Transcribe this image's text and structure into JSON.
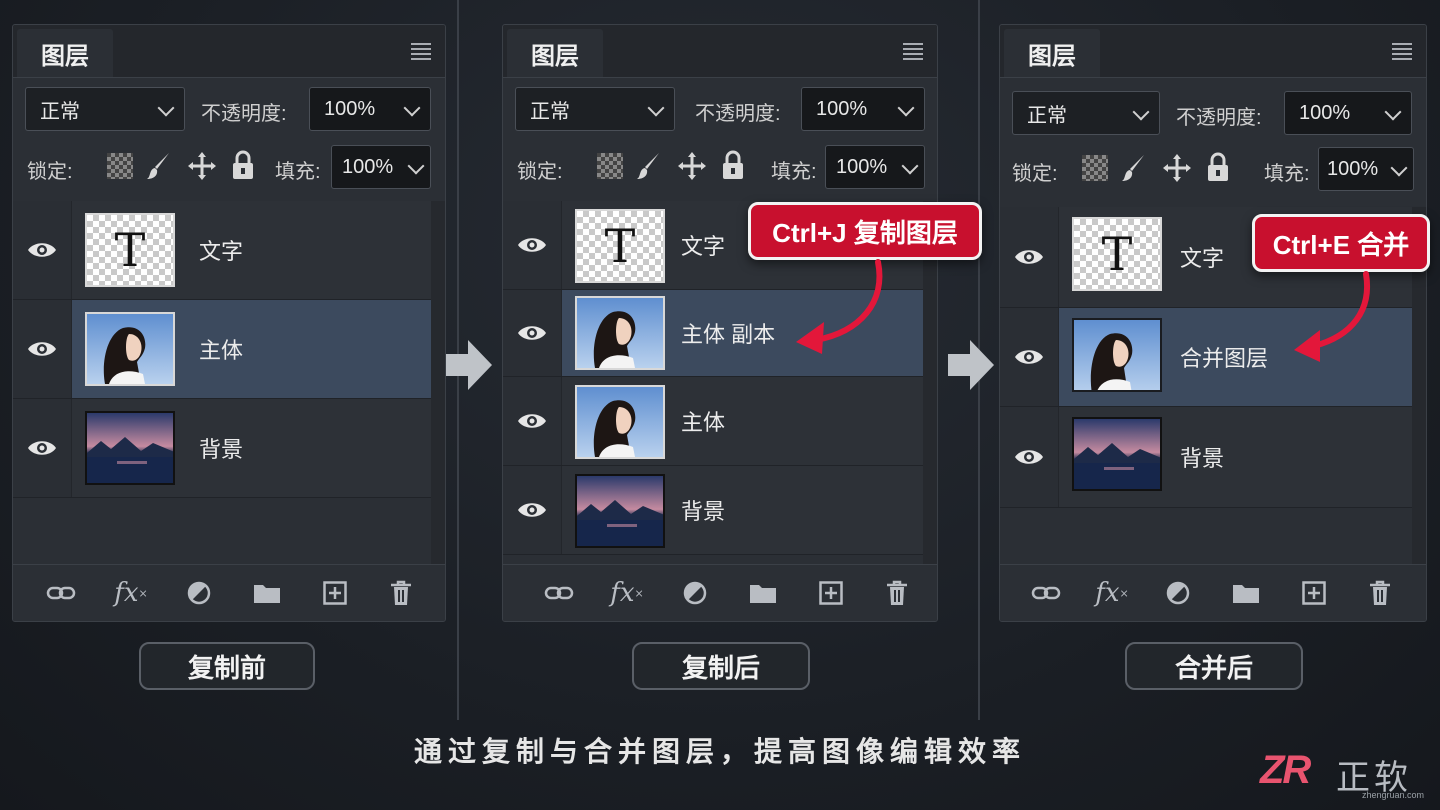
{
  "panels": [
    {
      "tab_title": "图层",
      "blend_mode": "正常",
      "opacity_label": "不透明度:",
      "opacity_value": "100%",
      "lock_label": "锁定:",
      "fill_label": "填充:",
      "fill_value": "100%",
      "layers": [
        {
          "name": "文字",
          "thumb": "text",
          "selected": false
        },
        {
          "name": "主体",
          "thumb": "portrait",
          "selected": true
        },
        {
          "name": "背景",
          "thumb": "landscape",
          "selected": false
        }
      ],
      "caption": "复制前"
    },
    {
      "tab_title": "图层",
      "blend_mode": "正常",
      "opacity_label": "不透明度:",
      "opacity_value": "100%",
      "lock_label": "锁定:",
      "fill_label": "填充:",
      "fill_value": "100%",
      "layers": [
        {
          "name": "文字",
          "thumb": "text",
          "selected": false
        },
        {
          "name": "主体 副本",
          "thumb": "portrait",
          "selected": true
        },
        {
          "name": "主体",
          "thumb": "portrait",
          "selected": false
        },
        {
          "name": "背景",
          "thumb": "landscape",
          "selected": false
        }
      ],
      "callout": "Ctrl+J 复制图层",
      "caption": "复制后"
    },
    {
      "tab_title": "图层",
      "blend_mode": "正常",
      "opacity_label": "不透明度:",
      "opacity_value": "100%",
      "lock_label": "锁定:",
      "fill_label": "填充:",
      "fill_value": "100%",
      "layers": [
        {
          "name": "文字",
          "thumb": "text",
          "selected": false
        },
        {
          "name": "合并图层",
          "thumb": "portrait",
          "selected": true
        },
        {
          "name": "背景",
          "thumb": "landscape",
          "selected": false
        }
      ],
      "callout": "Ctrl+E 合并",
      "caption": "合并后"
    }
  ],
  "text_thumb_glyph": "T",
  "fx_label": "fx",
  "bottom_caption": "通过复制与合并图层，提高图像编辑效率",
  "logo": {
    "mark": "ZR",
    "name": "正软",
    "url": "zhengruan.com"
  },
  "colors": {
    "accent_red": "#c8102e",
    "selected_row": "#3c4a5e",
    "panel_bg": "#2b2f35"
  }
}
